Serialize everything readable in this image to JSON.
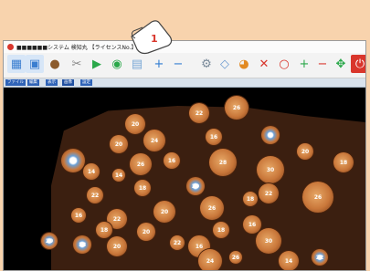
{
  "window": {
    "title": "■■■■■■システム 検知丸 【ライセンスNo.】"
  },
  "toolbar": {
    "buttons": [
      {
        "name": "grid-view-icon",
        "glyph": "▦",
        "color": "#3a7ed0"
      },
      {
        "name": "tile-view-icon",
        "glyph": "▣",
        "color": "#3a7ed0"
      },
      {
        "name": "wood-icon",
        "glyph": "●",
        "color": "#8b5a2b"
      },
      {
        "name": "tools-icon",
        "glyph": "✂",
        "color": "#888888"
      },
      {
        "name": "play-icon",
        "glyph": "▶",
        "color": "#2aa84a"
      },
      {
        "name": "recognize-icon",
        "glyph": "◉",
        "color": "#2aa84a"
      },
      {
        "name": "document-icon",
        "glyph": "▤",
        "color": "#7aa8d6"
      },
      {
        "name": "zoom-in-icon",
        "glyph": "+",
        "color": "#2f7bd1"
      },
      {
        "name": "zoom-out-icon",
        "glyph": "−",
        "color": "#2f7bd1"
      },
      {
        "name": "settings-icon",
        "glyph": "⚙",
        "color": "#7a8a9a"
      },
      {
        "name": "eraser-icon",
        "glyph": "◇",
        "color": "#6a9ad0"
      },
      {
        "name": "palette-icon",
        "glyph": "◕",
        "color": "#e28a22"
      },
      {
        "name": "delete-x-icon",
        "glyph": "✕",
        "color": "#d9362c"
      },
      {
        "name": "circle-icon",
        "glyph": "○",
        "color": "#d9362c"
      },
      {
        "name": "add-plus-icon",
        "glyph": "+",
        "color": "#2aa84a"
      },
      {
        "name": "minus-icon",
        "glyph": "−",
        "color": "#d9362c"
      },
      {
        "name": "move-icon",
        "glyph": "✥",
        "color": "#2aa84a"
      },
      {
        "name": "power-icon",
        "glyph": "⏻",
        "color": "#ffffff"
      }
    ]
  },
  "tabs": [
    "ファイル",
    "編集",
    "表示",
    "画像",
    "設定"
  ],
  "hand_label": "1",
  "logs": [
    {
      "n": "22"
    },
    {
      "n": "26"
    },
    {
      "n": "20"
    },
    {
      "n": "24"
    },
    {
      "n": "16"
    },
    {
      "n": "20"
    },
    {
      "n": "8"
    },
    {
      "n": "20"
    },
    {
      "n": "16"
    },
    {
      "n": "28"
    },
    {
      "n": "26"
    },
    {
      "n": "26"
    },
    {
      "n": "30"
    },
    {
      "n": "18"
    },
    {
      "n": "14"
    },
    {
      "n": "14"
    },
    {
      "n": "18"
    },
    {
      "n": "22"
    },
    {
      "n": "22"
    },
    {
      "n": "20"
    },
    {
      "n": "18"
    },
    {
      "n": "26"
    },
    {
      "n": "20"
    },
    {
      "n": "26"
    },
    {
      "n": "16"
    },
    {
      "n": "22"
    },
    {
      "n": "18"
    },
    {
      "n": "20"
    },
    {
      "n": "18"
    },
    {
      "n": "16"
    },
    {
      "n": "30"
    },
    {
      "n": "20"
    },
    {
      "n": "18"
    },
    {
      "n": "20"
    },
    {
      "n": "22"
    },
    {
      "n": "16"
    },
    {
      "n": "24"
    },
    {
      "n": "26"
    },
    {
      "n": "14"
    },
    {
      "n": "22"
    }
  ]
}
